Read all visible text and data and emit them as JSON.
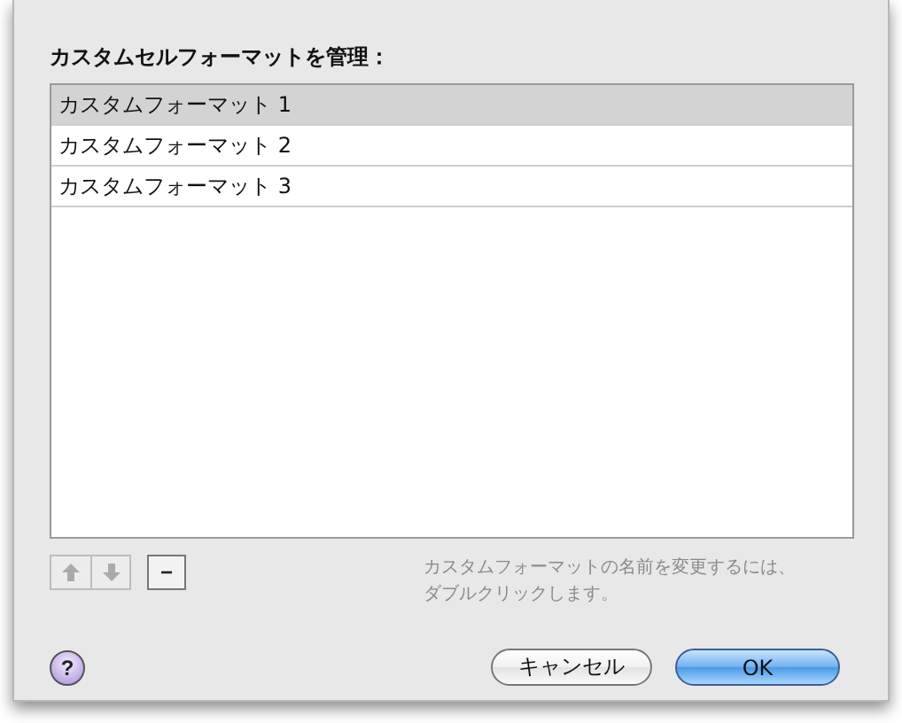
{
  "title": "カスタムセルフォーマットを管理：",
  "formats": [
    {
      "label": "カスタムフォーマット 1",
      "selected": true
    },
    {
      "label": "カスタムフォーマット 2",
      "selected": false
    },
    {
      "label": "カスタムフォーマット 3",
      "selected": false
    }
  ],
  "move_buttons": {
    "disabled": true
  },
  "remove_button": {
    "label": "−"
  },
  "hint": [
    "カスタムフォーマットの名前を変更するには、",
    "ダブルクリックします。"
  ],
  "help": {
    "label": "?"
  },
  "buttons": [
    {
      "label": "キャンセル",
      "kind": "cancel"
    },
    {
      "label": "OK",
      "kind": "default"
    }
  ]
}
